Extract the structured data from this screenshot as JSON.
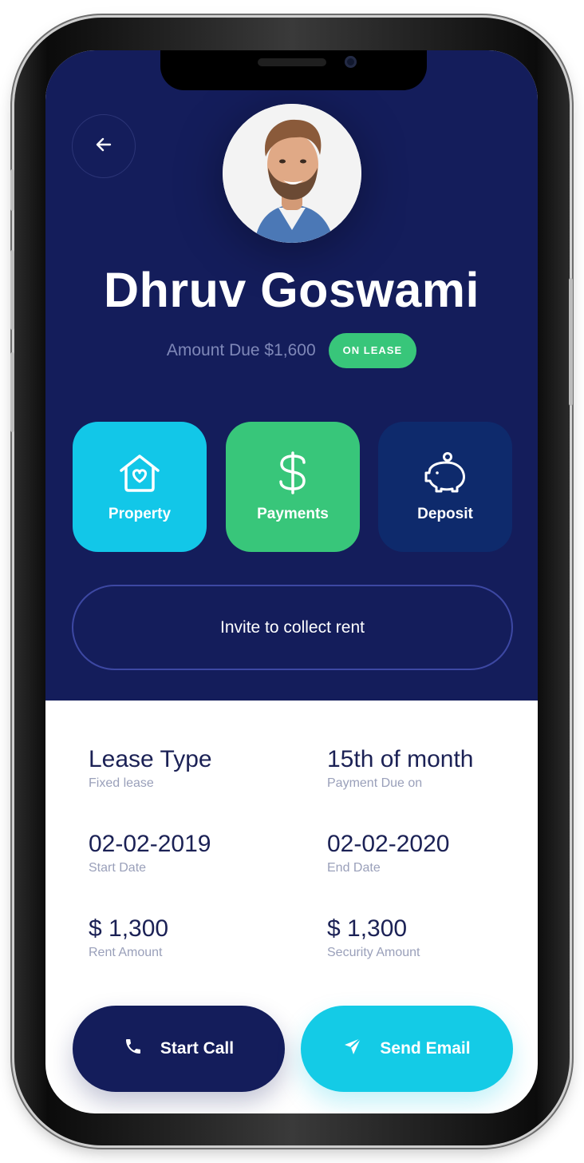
{
  "profile": {
    "name": "Dhruv Goswami",
    "amount_due": "Amount Due $1,600",
    "status_badge": "ON LEASE"
  },
  "actions": {
    "property_label": "Property",
    "payments_label": "Payments",
    "deposit_label": "Deposit",
    "invite_label": "Invite to collect rent"
  },
  "details": {
    "lease_type_value": "Lease Type",
    "lease_type_caption": "Fixed lease",
    "payment_due_value": "15th of month",
    "payment_due_caption": "Payment Due on",
    "start_date_value": "02-02-2019",
    "start_date_caption": "Start Date",
    "end_date_value": "02-02-2020",
    "end_date_caption": "End Date",
    "rent_value": "$ 1,300",
    "rent_caption": "Rent Amount",
    "security_value": "$ 1,300",
    "security_caption": "Security Amount"
  },
  "buttons": {
    "call_label": "Start Call",
    "email_label": "Send Email"
  },
  "colors": {
    "header_bg": "#141d5b",
    "cyan": "#12c7e8",
    "green": "#38c67a",
    "deposit_blue": "#0e2a6c"
  },
  "icons": {
    "back": "arrow-left-icon",
    "property": "house-heart-icon",
    "payments": "dollar-icon",
    "deposit": "piggy-bank-icon",
    "call": "phone-icon",
    "email": "send-icon"
  }
}
